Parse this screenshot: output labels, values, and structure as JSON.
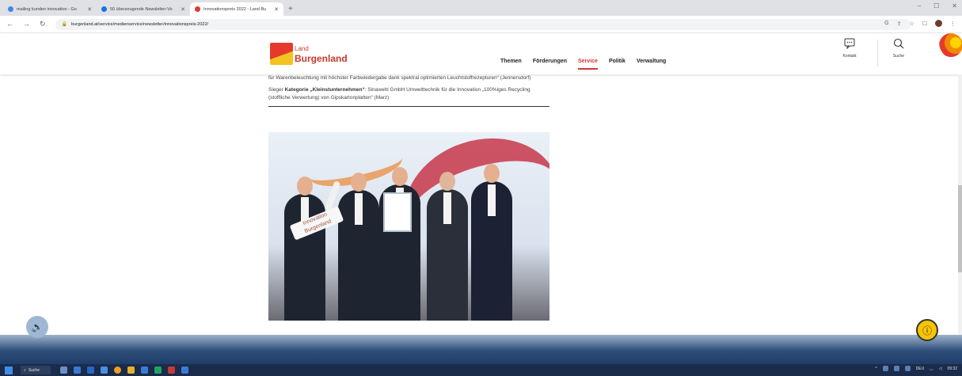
{
  "browser": {
    "tabs": [
      {
        "title": "mailing kunden innovation - Go",
        "favicon_color": "#4285f4",
        "active": false
      },
      {
        "title": "50 überzeugende Newsletter-Vo",
        "favicon_color": "#1a73e8",
        "active": false
      },
      {
        "title": "Innovationspreis 2022 - Land Bu",
        "favicon_color": "#e53a2b",
        "active": true
      }
    ],
    "new_tab": "+",
    "url": "burgenland.at/service/medienservice/newsletter/innovationspreis-2022/"
  },
  "site": {
    "logo": {
      "line1": "Land",
      "line2": "Burgenland"
    },
    "nav": [
      {
        "label": "Themen",
        "active": false
      },
      {
        "label": "Förderungen",
        "active": false
      },
      {
        "label": "Service",
        "active": true
      },
      {
        "label": "Politik",
        "active": false
      },
      {
        "label": "Verwaltung",
        "active": false
      }
    ],
    "contact_label": "Kontakt",
    "search_label": "Suche",
    "accent_color": "#d6333b"
  },
  "article": {
    "para1": "für Warenbeleuchtung mit höchster Farbwiedergabe dank spektral optimierten Leuchtstoffrezepturen“ (Jennersdorf)",
    "para2_prefix": "Sieger ",
    "para2_bold": "Kategorie „Kleinstunternehmen“",
    "para2_rest": ": Sinawehl GmbH Umwelttechnik für die Innovation „100%iges Recycling (stoffliche Verwertung) von Gipskartonplatten“ (Marz)",
    "photo_sign_line1": "Innovation",
    "photo_sign_line2": "Burgenland"
  },
  "taskbar": {
    "search": "Suche",
    "lang": "DEU",
    "time": "09:32"
  }
}
